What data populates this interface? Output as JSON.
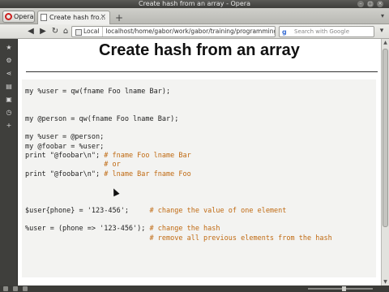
{
  "window": {
    "title": "Create hash from an array - Opera"
  },
  "tabbar": {
    "menu_label": "Opera",
    "tabs": [
      {
        "label": "Create hash fro...",
        "close": "×"
      }
    ],
    "new_tab": "+",
    "right_control": "▾"
  },
  "addressbar": {
    "back": "◀",
    "forward": "▶",
    "reload": "↻",
    "home": "⌂",
    "local_label": "Local",
    "url": "localhost/home/gabor/work/gabor/training/programming_per",
    "search_placeholder": "Search with Google",
    "search_engine": "g"
  },
  "sidepanel": {
    "icons": [
      "star-icon",
      "gear-icon",
      "share-icon",
      "notes-icon",
      "downloads-icon",
      "history-icon",
      "add-icon"
    ]
  },
  "page": {
    "title": "Create hash from an array",
    "code_lines": [
      {
        "code": "my %user = qw(fname Foo lname Bar);",
        "comment": ""
      },
      {
        "code": "",
        "comment": ""
      },
      {
        "code": "",
        "comment": ""
      },
      {
        "code": "my @person = qw(fname Foo lname Bar);",
        "comment": ""
      },
      {
        "code": "",
        "comment": ""
      },
      {
        "code": "my %user = @person;",
        "comment": ""
      },
      {
        "code": "my @foobar = %user;",
        "comment": ""
      },
      {
        "code": "print \"@foobar\\n\"; ",
        "comment": "# fname Foo lname Bar"
      },
      {
        "code": "                   ",
        "comment": "# or"
      },
      {
        "code": "print \"@foobar\\n\"; ",
        "comment": "# lname Bar fname Foo"
      },
      {
        "code": "",
        "comment": ""
      },
      {
        "code": "",
        "comment": ""
      },
      {
        "code": "",
        "comment": ""
      },
      {
        "code": "$user{phone} = '123-456';     ",
        "comment": "# change the value of one element"
      },
      {
        "code": "",
        "comment": ""
      },
      {
        "code": "%user = (phone => '123-456'); ",
        "comment": "# change the hash"
      },
      {
        "code": "                              ",
        "comment": "# remove all previous elements from the hash"
      }
    ]
  },
  "colors": {
    "comment": "#c06a12",
    "titlebar": "#3e3e3b",
    "code_background": "#f3f3f1"
  }
}
